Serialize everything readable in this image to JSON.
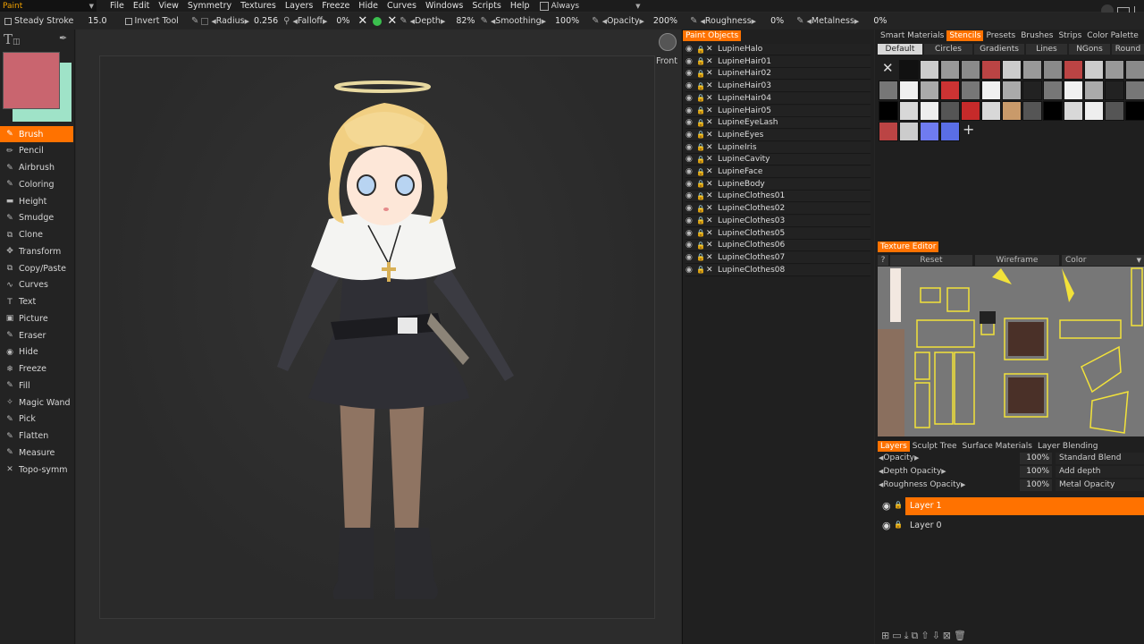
{
  "menubar": {
    "room": "Paint",
    "items": [
      "File",
      "Edit",
      "View",
      "Symmetry",
      "Textures",
      "Layers",
      "Freeze",
      "Hide",
      "Curves",
      "Windows",
      "Scripts",
      "Help"
    ],
    "always_label": "Always"
  },
  "toolbar": {
    "steady_stroke_label": "Steady  Stroke",
    "steady_stroke_value": "15.0",
    "invert_tool_label": "Invert  Tool",
    "radius_label": "Radius",
    "radius_value": "0.256",
    "falloff_label": "Falloff",
    "falloff_value": "0%",
    "depth_label": "Depth",
    "depth_value": "82%",
    "smoothing_label": "Smoothing",
    "smoothing_value": "100%",
    "opacity_label": "Opacity",
    "opacity_value": "200%",
    "roughness_label": "Roughness",
    "roughness_value": "0%",
    "metalness_label": "Metalness",
    "metalness_value": "0%"
  },
  "colors": {
    "foreground": "#c9656f",
    "background": "#9fe3c8",
    "accent": "#ff7200"
  },
  "tools": [
    {
      "label": "Brush",
      "icon": "brush-icon",
      "active": true
    },
    {
      "label": "Pencil",
      "icon": "pencil-icon"
    },
    {
      "label": "Airbrush",
      "icon": "airbrush-icon"
    },
    {
      "label": "Coloring",
      "icon": "coloring-icon"
    },
    {
      "label": "Height",
      "icon": "height-icon"
    },
    {
      "label": "Smudge",
      "icon": "smudge-icon"
    },
    {
      "label": "Clone",
      "icon": "clone-icon"
    },
    {
      "label": "Transform",
      "icon": "transform-icon"
    },
    {
      "label": "Copy/Paste",
      "icon": "copy-paste-icon"
    },
    {
      "label": "Curves",
      "icon": "curves-icon"
    },
    {
      "label": "Text",
      "icon": "text-icon"
    },
    {
      "label": "Picture",
      "icon": "picture-icon"
    },
    {
      "label": "Eraser",
      "icon": "eraser-icon"
    },
    {
      "label": "Hide",
      "icon": "hide-icon"
    },
    {
      "label": "Freeze",
      "icon": "freeze-icon"
    },
    {
      "label": "Fill",
      "icon": "fill-icon"
    },
    {
      "label": "Magic  Wand",
      "icon": "magic-wand-icon"
    },
    {
      "label": "Pick",
      "icon": "pick-icon"
    },
    {
      "label": "Flatten",
      "icon": "flatten-icon"
    },
    {
      "label": "Measure",
      "icon": "measure-icon"
    },
    {
      "label": "Topo-symm",
      "icon": "topo-symm-icon"
    }
  ],
  "viewport": {
    "view_label": "Front"
  },
  "paint_objects": {
    "tabs": [
      "Paint  Objects"
    ],
    "items": [
      "LupineHalo",
      "LupineHair01",
      "LupineHair02",
      "LupineHair03",
      "LupineHair04",
      "LupineHair05",
      "LupineEyeLash",
      "LupineEyes",
      "LupineIris",
      "LupineCavity",
      "LupineFace",
      "LupineBody",
      "LupineClothes01",
      "LupineClothes02",
      "LupineClothes03",
      "LupineClothes05",
      "LupineClothes06",
      "LupineClothes07",
      "LupineClothes08"
    ]
  },
  "stencils": {
    "tabs": [
      "Smart  Materials",
      "Stencils",
      "Presets",
      "Brushes",
      "Strips",
      "Color  Palette"
    ],
    "subtabs": [
      "Default",
      "Circles",
      "Gradients",
      "Lines",
      "NGons",
      "Round"
    ]
  },
  "texture_editor": {
    "title": "Texture  Editor",
    "help": "?",
    "reset": "Reset",
    "wireframe": "Wireframe",
    "color": "Color"
  },
  "layers_panel": {
    "tabs": [
      "Layers",
      "Sculpt  Tree",
      "Surface  Materials",
      "Layer  Blending"
    ],
    "rows": [
      {
        "label": "Opacity",
        "value": "100%",
        "mode": "Standard  Blend"
      },
      {
        "label": "Depth  Opacity",
        "value": "100%",
        "mode": "Add  depth"
      },
      {
        "label": "Roughness  Opacity",
        "value": "100%",
        "mode": "Metal  Opacity"
      }
    ],
    "layers": [
      {
        "name": "Layer  1",
        "selected": true
      },
      {
        "name": "Layer  0",
        "selected": false
      }
    ]
  }
}
